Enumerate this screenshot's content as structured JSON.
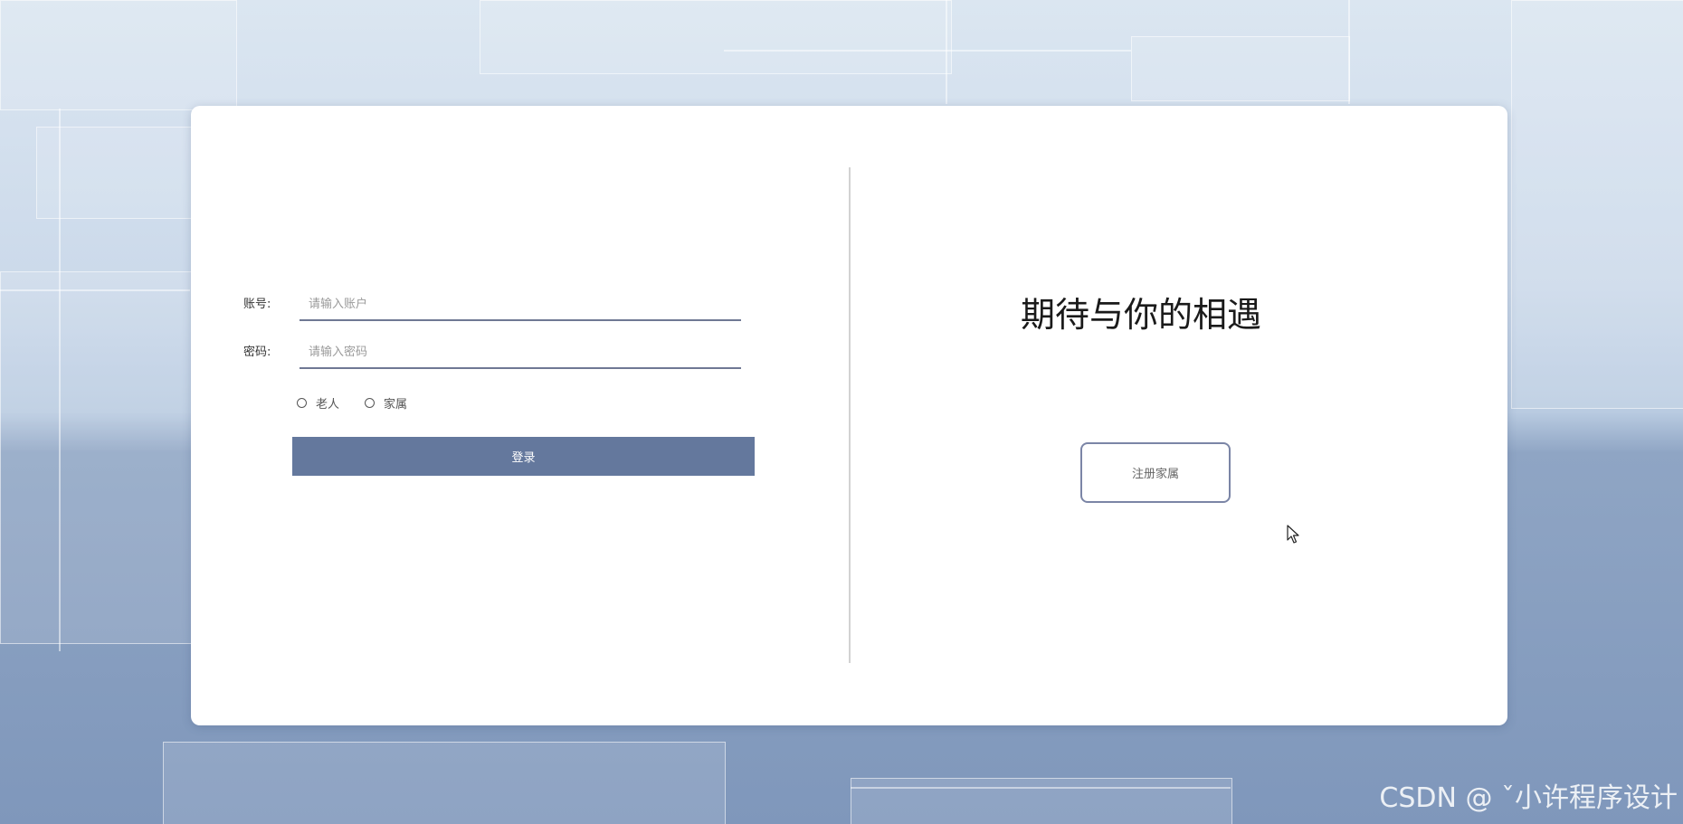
{
  "login": {
    "account_label": "账号:",
    "account_placeholder": "请输入账户",
    "password_label": "密码:",
    "password_placeholder": "请输入密码",
    "roles": [
      {
        "label": "老人",
        "selected": false
      },
      {
        "label": "家属",
        "selected": false
      }
    ],
    "submit_label": "登录"
  },
  "welcome": {
    "headline": "期待与你的相遇",
    "register_label": "注册家属"
  },
  "watermark": "CSDN @ ˇ小许程序设计",
  "colors": {
    "primary_button": "#64789d",
    "input_underline": "#6f7894",
    "register_border": "#7b85a6"
  },
  "icons": {
    "cursor": "mouse-pointer-icon"
  }
}
